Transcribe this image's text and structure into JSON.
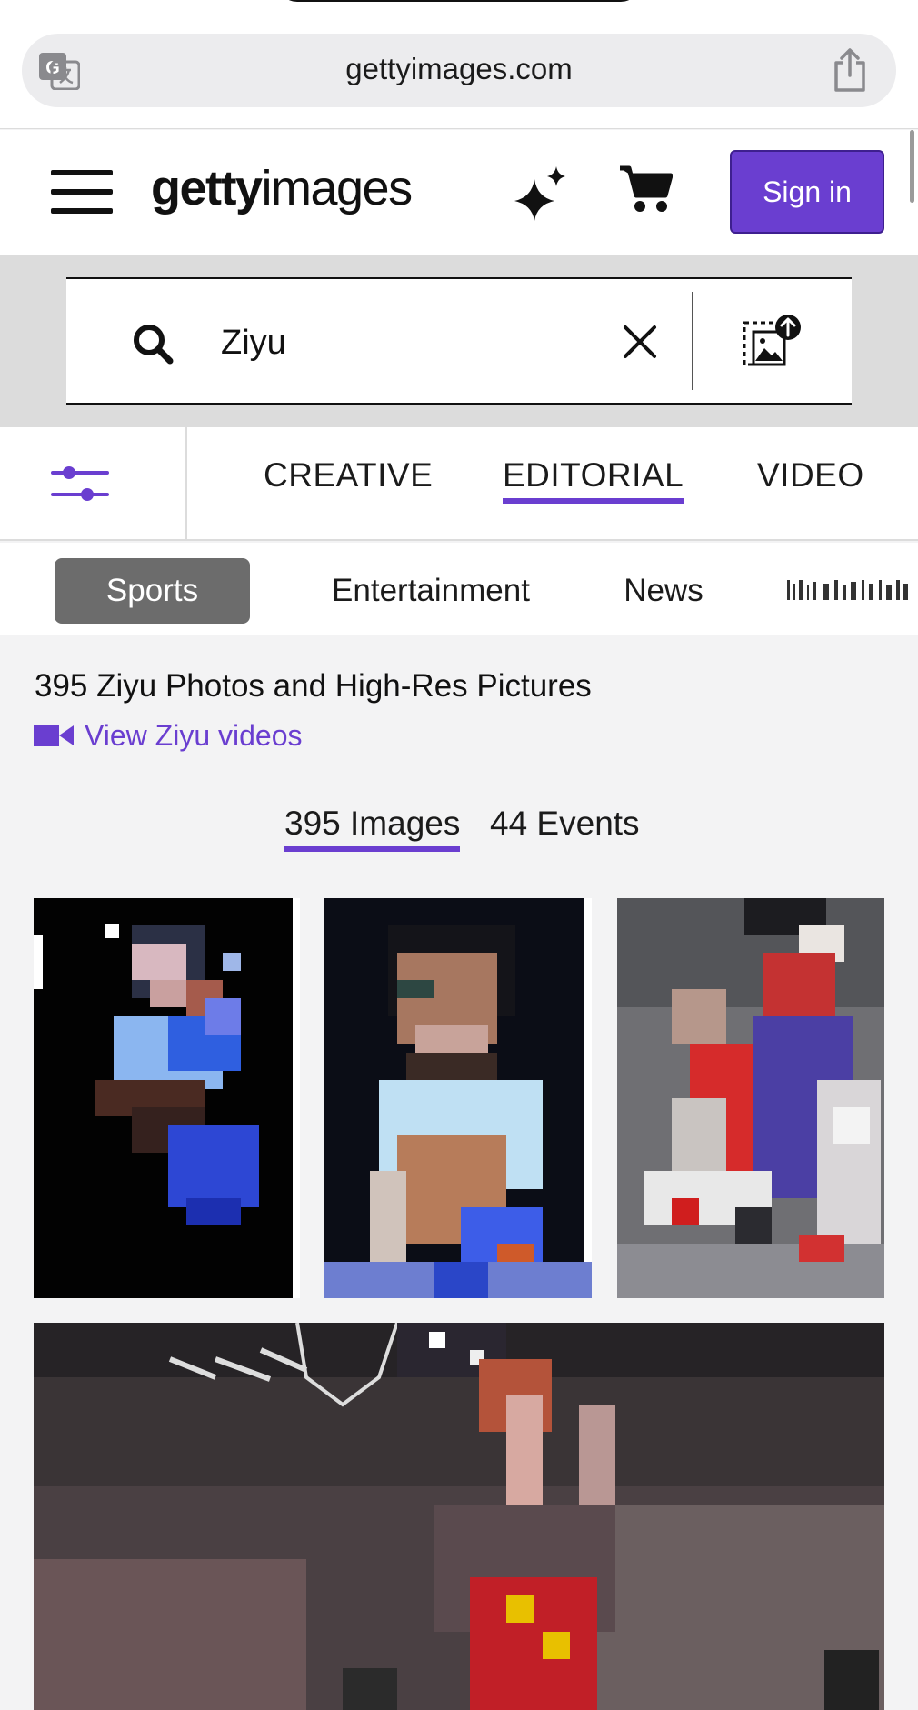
{
  "browser": {
    "url": "gettyimages.com",
    "icons": {
      "translate": "translate-icon",
      "share": "share-icon"
    }
  },
  "header": {
    "menu_icon": "hamburger-menu-icon",
    "logo_bold": "getty",
    "logo_light": "images",
    "ai_icon": "sparkle-icon",
    "cart_icon": "cart-icon",
    "signin_label": "Sign in",
    "accent_color": "#6a3ed0"
  },
  "search": {
    "value": "Ziyu",
    "icons": {
      "search": "search-icon",
      "clear": "close-icon",
      "image_search": "image-upload-icon"
    }
  },
  "type_tabs": [
    {
      "label": "CREATIVE",
      "active": false
    },
    {
      "label": "EDITORIAL",
      "active": true
    },
    {
      "label": "VIDEO",
      "active": false
    }
  ],
  "filter_icon": "sliders-icon",
  "categories": [
    {
      "label": "Sports",
      "active": true
    },
    {
      "label": "Entertainment",
      "active": false
    },
    {
      "label": "News",
      "active": false
    }
  ],
  "results": {
    "title": "395 Ziyu Photos and High-Res Pictures",
    "video_link": "View Ziyu videos",
    "count_tabs": [
      {
        "label": "395 Images",
        "active": true
      },
      {
        "label": "44 Events",
        "active": false
      }
    ]
  },
  "thumbnails": [
    {
      "name": "athlete-portrait-blue-jersey"
    },
    {
      "name": "athlete-portrait-light-blue-jersey"
    },
    {
      "name": "basketball-game-red-jersey"
    },
    {
      "name": "basketball-arena-rebound"
    }
  ]
}
